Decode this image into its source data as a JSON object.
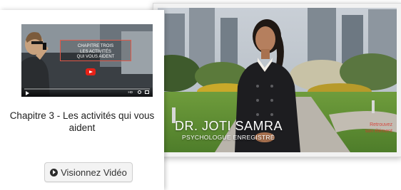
{
  "main_video": {
    "presenter_name": "DR. JOTI SAMRA",
    "presenter_title": "PSYCHOLOGUE ENREGISTRÉ",
    "brand_lines": [
      "Retrouvez",
      "son élément"
    ]
  },
  "card": {
    "thumbnail": {
      "overlay_lines": [
        "CHAPITRE TROIS",
        "LES ACTIVITÉS",
        "QUI VOUS AIDENT"
      ],
      "hd_label": "HD"
    },
    "title": "Chapitre 3 - Les activités qui vous aident",
    "watch_button_label": "Visionnez Vidéo",
    "watch_button_icon": "play-circle-icon"
  }
}
